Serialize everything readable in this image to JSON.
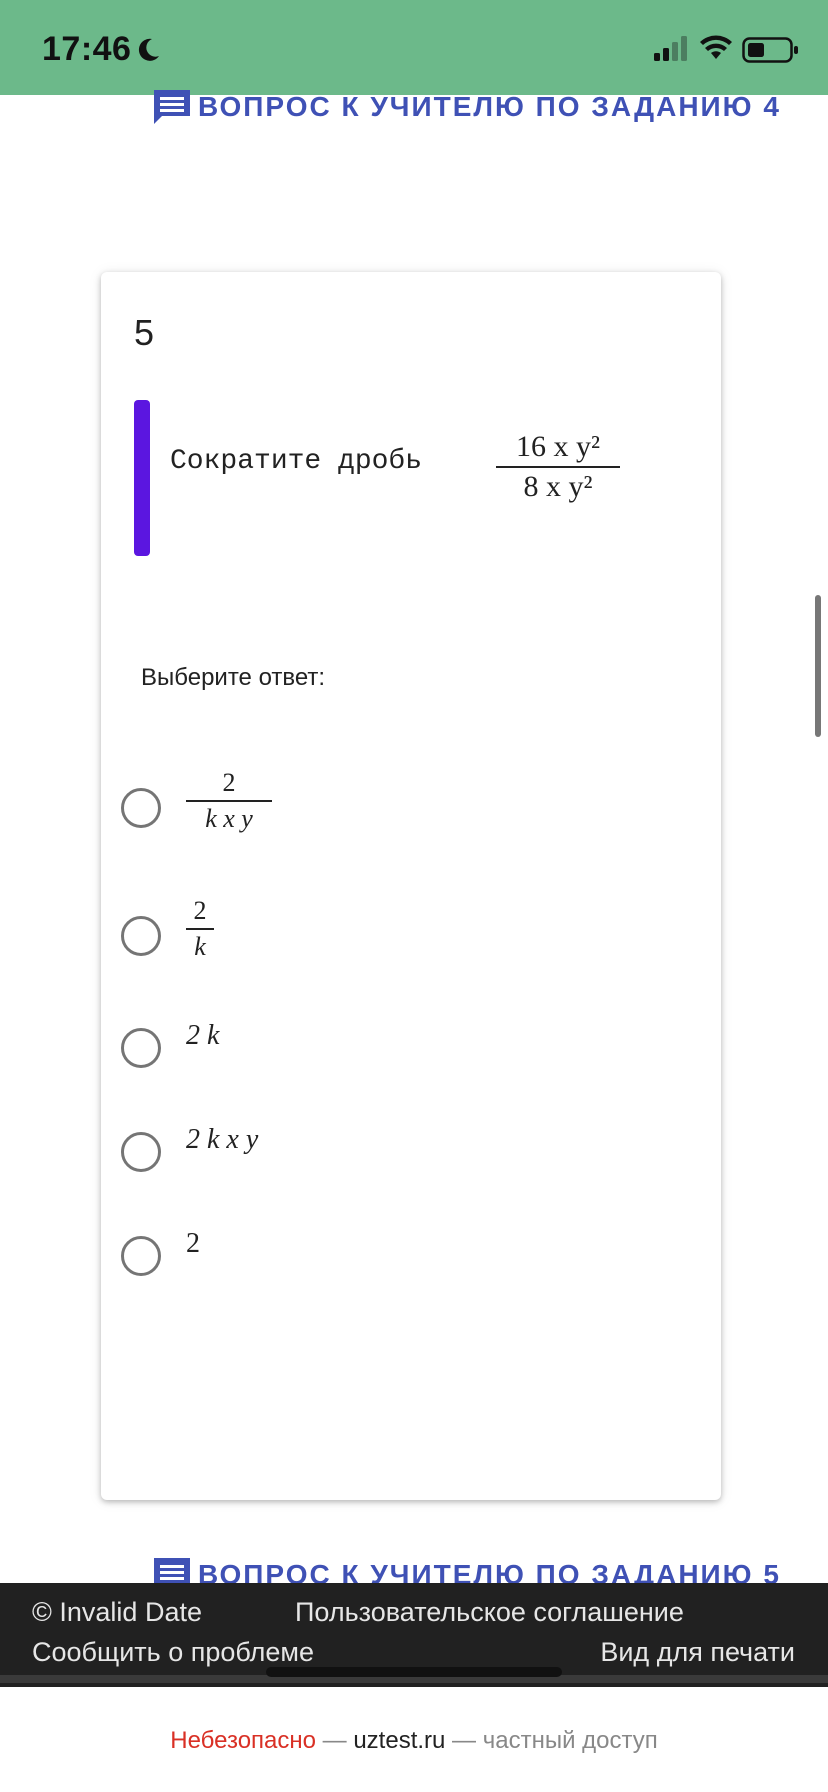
{
  "status_bar": {
    "time": "17:46",
    "icons": [
      "moon-icon",
      "signal-icon",
      "wifi-icon",
      "battery-icon"
    ],
    "background": "#6cb98a"
  },
  "links": {
    "prev_question": "ВОПРОС К УЧИТЕЛЮ ПО ЗАДАНИЮ 4",
    "next_question": "ВОПРОС К УЧИТЕЛЮ ПО ЗАДАНИЮ 5",
    "color": "#3f51b5"
  },
  "question": {
    "number": "5",
    "text": "Сократите дробь",
    "fraction": {
      "numerator": "16 x y²",
      "denominator": "8 x y²"
    },
    "accent": "#5b16e0"
  },
  "answer_prompt": "Выберите ответ:",
  "options": [
    {
      "type": "fraction",
      "numerator": "2",
      "denominator": "k x y"
    },
    {
      "type": "fraction",
      "numerator": "2",
      "denominator": "k"
    },
    {
      "type": "text",
      "value": "2 k"
    },
    {
      "type": "text",
      "value": "2 k x y"
    },
    {
      "type": "text",
      "value": "2"
    }
  ],
  "footer": {
    "copyright": "© Invalid Date",
    "terms": "Пользовательское соглашение",
    "report": "Сообщить о проблеме",
    "print": "Вид для печати"
  },
  "browser": {
    "insecure": "Небезопасно",
    "separator1": " — ",
    "domain": "uztest.ru",
    "separator2": " — ",
    "mode": "частный доступ"
  }
}
